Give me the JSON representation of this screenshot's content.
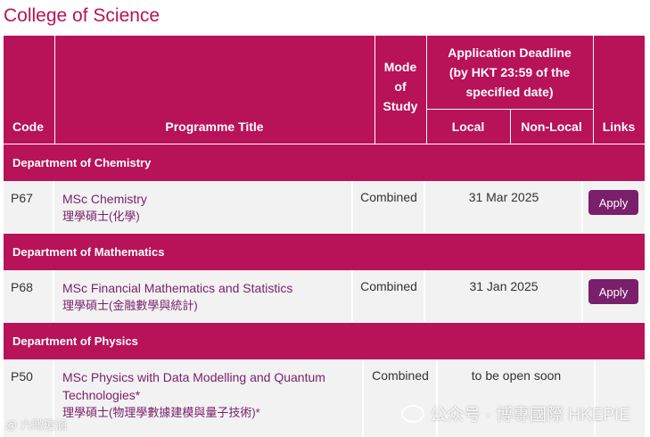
{
  "college_title": "College of Science",
  "header": {
    "code": "Code",
    "programme_title": "Programme Title",
    "mode_of_study": [
      "Mode",
      "of",
      "Study"
    ],
    "deadline": [
      "Application Deadline",
      "(by HKT 23:59 of the",
      "specified date)"
    ],
    "local": "Local",
    "non_local": "Non-Local",
    "links": "Links"
  },
  "departments": [
    {
      "name": "Department of Chemistry",
      "programmes": [
        {
          "code": "P67",
          "title_en": "MSc Chemistry",
          "title_zh": "理學碩士(化學)",
          "mode": "Combined",
          "deadline": "31 Mar 2025",
          "link": "Apply"
        }
      ]
    },
    {
      "name": "Department of Mathematics",
      "programmes": [
        {
          "code": "P68",
          "title_en": "MSc Financial Mathematics and Statistics",
          "title_zh": "理學碩士(金融數學與統計)",
          "mode": "Combined",
          "deadline": "31 Jan 2025",
          "link": "Apply"
        }
      ]
    },
    {
      "name": "Department of Physics",
      "programmes": [
        {
          "code": "P50",
          "title_en_line1": "MSc Physics with Data Modelling and Quantum",
          "title_en_line2": "Technologies*",
          "title_zh": "理學碩士(物理學數據建模與量子技術)*",
          "mode": "Combined",
          "deadline": "to be open soon"
        }
      ]
    }
  ],
  "watermarks": {
    "right": "公众号 · 博專國際 HKEPIE",
    "left": "@ 六瞰瓊滷"
  },
  "colors": {
    "header_bg": "#b81259",
    "link": "#7a1f6b",
    "row_bg": "#f2f2f2"
  }
}
